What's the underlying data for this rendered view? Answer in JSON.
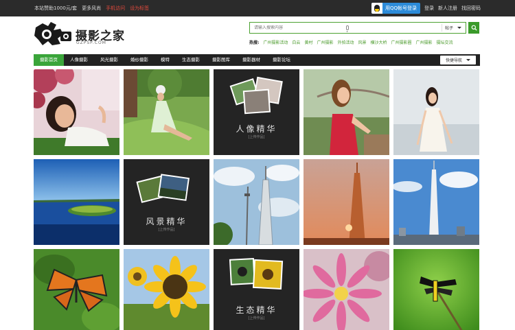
{
  "topbar": {
    "links": [
      "本站赞助1000元/套",
      "更多风尚",
      "手机访问",
      "设为标签"
    ],
    "qq_login": "用QQ帐号登录",
    "login": "登录",
    "register": "新人注册",
    "forgot": "找回密码"
  },
  "logo": {
    "title": "摄影之家",
    "subtitle": "GZPSP.COM"
  },
  "search": {
    "placeholder": "请输入搜索内容",
    "select_value": "帖子",
    "hot_label": "热搜:",
    "hot_links": [
      "广州摄影活动",
      "白云",
      "黄村",
      "广州摄影",
      "外拍活动",
      "风景",
      "横沙大桥",
      "广州摄影圈",
      "广州摄影",
      "摄坛交流"
    ]
  },
  "nav": {
    "items": [
      "摄影首页",
      "人像摄影",
      "风光摄影",
      "婚纱摄影",
      "模特",
      "生态摄影",
      "摄影图库",
      "摄影器材",
      "摄影论坛"
    ],
    "active_index": 0,
    "quick_label": "快捷导航"
  },
  "features": {
    "portrait": {
      "title": "人像精华",
      "sub": "[上传作品]"
    },
    "landscape": {
      "title": "风景精华",
      "sub": "[上传作品]"
    },
    "ecology": {
      "title": "生态精华",
      "sub": "[上传作品]"
    }
  },
  "tiles": [
    {
      "name": "photo-portrait-woman-flowers",
      "kind": "photo"
    },
    {
      "name": "photo-portrait-woman-grass",
      "kind": "photo"
    },
    {
      "name": "feature-portrait",
      "kind": "feature"
    },
    {
      "name": "photo-portrait-woman-red",
      "kind": "photo"
    },
    {
      "name": "photo-portrait-woman-white",
      "kind": "photo"
    },
    {
      "name": "photo-lake-island",
      "kind": "photo"
    },
    {
      "name": "feature-landscape",
      "kind": "feature"
    },
    {
      "name": "photo-canton-tower-sky",
      "kind": "photo"
    },
    {
      "name": "photo-canton-tower-sunset",
      "kind": "photo"
    },
    {
      "name": "photo-canton-tower-city",
      "kind": "photo"
    },
    {
      "name": "photo-butterfly",
      "kind": "photo"
    },
    {
      "name": "photo-sunflower",
      "kind": "photo"
    },
    {
      "name": "feature-ecology",
      "kind": "feature"
    },
    {
      "name": "photo-pink-flower",
      "kind": "photo"
    },
    {
      "name": "photo-dragonfly",
      "kind": "photo"
    }
  ],
  "colors": {
    "accent_green": "#3aa53a",
    "topbar_bg": "#2b2b2b",
    "nav_bg": "#222222",
    "qq_blue": "#2c8bd9"
  },
  "icons": [
    "qq-avatar-icon",
    "microphone-icon",
    "search-icon",
    "camera-logo-icon",
    "caret-down-icon"
  ]
}
